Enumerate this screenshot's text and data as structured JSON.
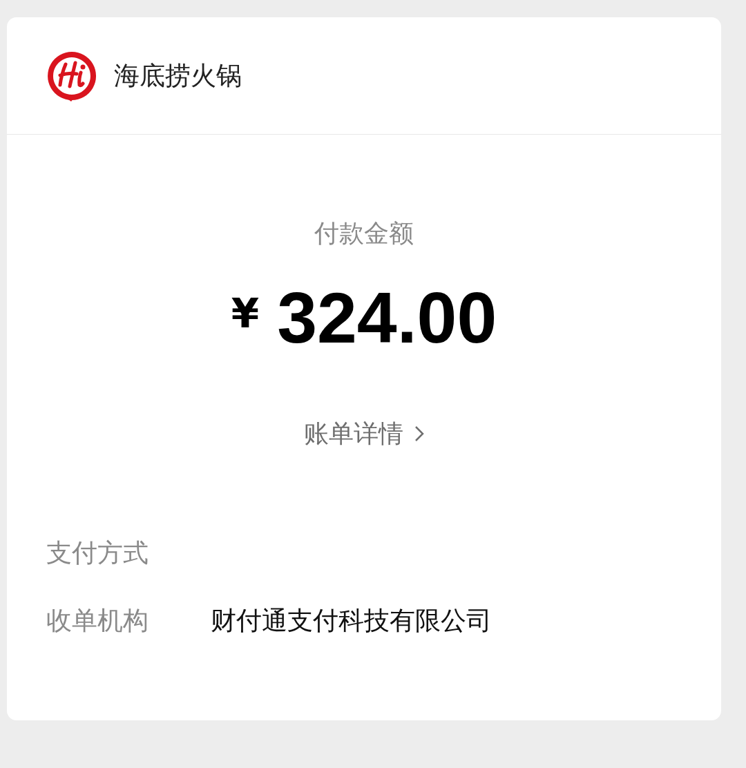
{
  "merchant": {
    "name": "海底捞火锅"
  },
  "payment": {
    "label": "付款金额",
    "currency": "¥",
    "amount": "324.00"
  },
  "bill_link": {
    "label": "账单详情"
  },
  "details": [
    {
      "label": "支付方式"
    },
    {
      "label": "收单机构",
      "value": "财付通支付科技有限公司"
    }
  ]
}
